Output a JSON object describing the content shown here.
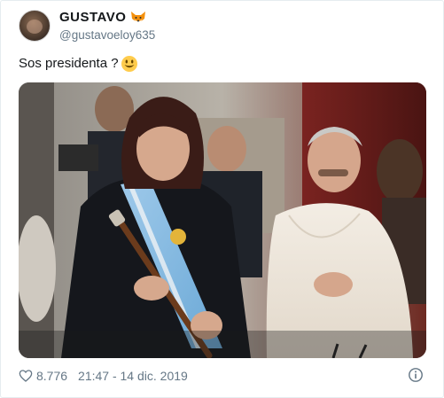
{
  "tweet": {
    "display_name": "GUSTAVO",
    "handle": "@gustavoeloy635",
    "text": "Sos presidenta ?",
    "likes": "8.776",
    "timestamp": "21:47 - 14 dic. 2019",
    "icons": {
      "avatar": "profile-avatar",
      "name_emoji": "fox-face-icon",
      "text_emoji": "smiley-icon",
      "like": "heart-icon",
      "info": "info-icon"
    },
    "colors": {
      "text": "#14171a",
      "secondary": "#657786",
      "border": "#e6ecf0",
      "fox": "#f4900c",
      "smiley": "#ffcc4d"
    }
  }
}
